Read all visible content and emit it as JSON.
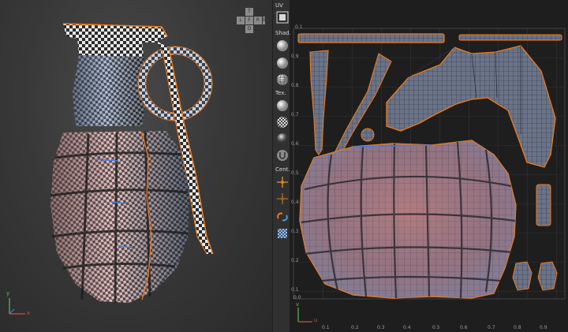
{
  "toolbar": {
    "uv_label": "UV",
    "shading_label": "Shad.",
    "texture_label": "Tex.",
    "center_label": "Cent."
  },
  "viewport": {
    "navcube_letters": [
      "T",
      "L",
      "F",
      "R",
      "B",
      "D"
    ],
    "axis_y": "y",
    "axis_x": "x"
  },
  "uv": {
    "top_left_label": "0.1",
    "left_ticks": [
      "0.1",
      "0.9",
      "0.8",
      "0.7",
      "0.6",
      "0.5",
      "0.4",
      "0.3",
      "0.2",
      "0.1",
      "0.0"
    ],
    "bottom_ticks": [
      "0.1",
      "0.2",
      "0.3",
      "0.4",
      "0.5",
      "0.6",
      "0.7",
      "0.8",
      "0.9"
    ],
    "axis_v": "v",
    "axis_u": "u"
  },
  "colors": {
    "checker_dark": "#2b2b2b",
    "checker_light": "#e8e8e8",
    "tint_blue": "#6f86b0",
    "tint_red": "#c88686",
    "selection_orange": "#f07a1a",
    "uv_grid": "#3a3a3a"
  },
  "icons": [
    "uv-frame-icon",
    "sphere-icon",
    "sphere-icon",
    "wire-sphere-icon",
    "sphere-icon",
    "checker-sphere-icon",
    "chrome-sphere-icon",
    "magnet-icon",
    "move-gizmo-icon",
    "move-gizmo-icon",
    "link-icon",
    "checker-texture-icon"
  ]
}
